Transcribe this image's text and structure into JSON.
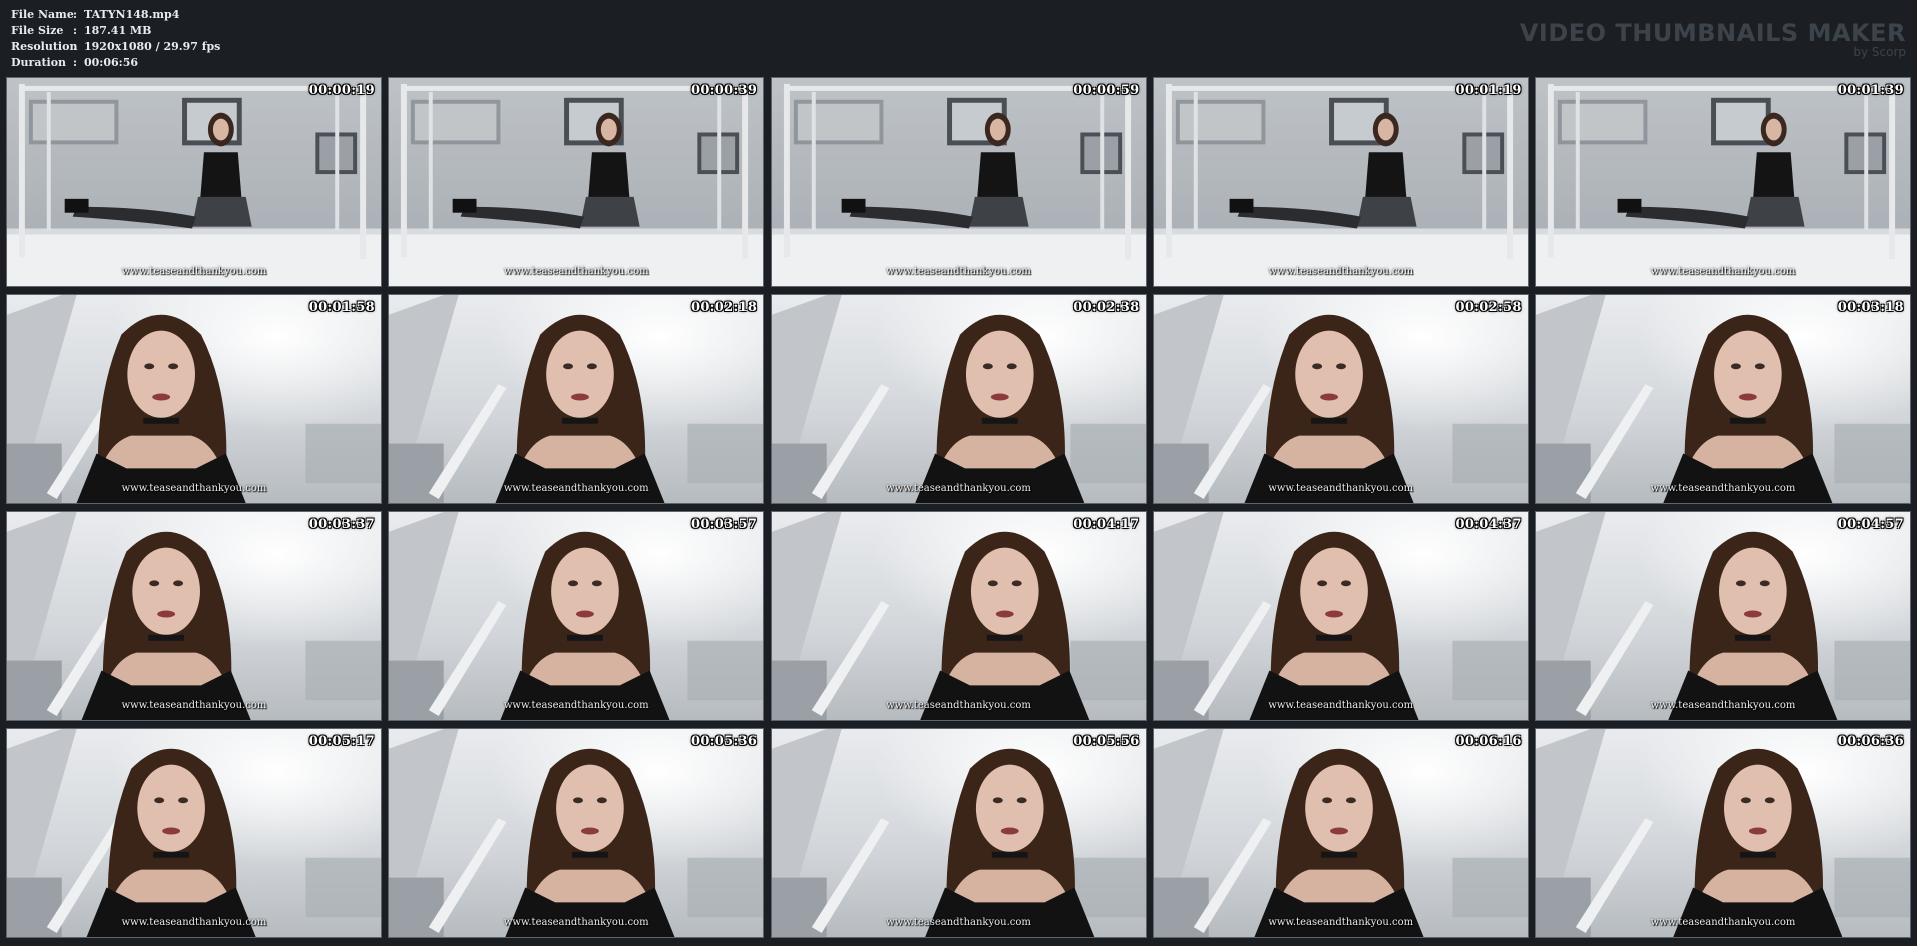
{
  "file_info": [
    {
      "key": "File Name",
      "value": "TATYN148.mp4"
    },
    {
      "key": "File Size",
      "value": "187.41 MB"
    },
    {
      "key": "Resolution",
      "value": "1920x1080 / 29.97 fps"
    },
    {
      "key": "Duration",
      "value": "00:06:56"
    }
  ],
  "separator": ":",
  "brand": {
    "title": "VIDEO THUMBNAILS MAKER",
    "subtitle": "by Scorp"
  },
  "watermark": "www.teaseandthankyou.com",
  "colors": {
    "background": "#1b1f24",
    "header_text": "#e9ecef",
    "brand_text": "#3c434b",
    "thumb_border": "#5d666e"
  },
  "thumbnails": [
    {
      "time": "00:00:19",
      "scene": "bed"
    },
    {
      "time": "00:00:39",
      "scene": "bed"
    },
    {
      "time": "00:00:59",
      "scene": "bed"
    },
    {
      "time": "00:01:19",
      "scene": "bed"
    },
    {
      "time": "00:01:39",
      "scene": "bed"
    },
    {
      "time": "00:01:58",
      "scene": "closeup"
    },
    {
      "time": "00:02:18",
      "scene": "closeup"
    },
    {
      "time": "00:02:38",
      "scene": "closeup"
    },
    {
      "time": "00:02:58",
      "scene": "closeup"
    },
    {
      "time": "00:03:18",
      "scene": "closeup"
    },
    {
      "time": "00:03:37",
      "scene": "closeup"
    },
    {
      "time": "00:03:57",
      "scene": "closeup"
    },
    {
      "time": "00:04:17",
      "scene": "closeup"
    },
    {
      "time": "00:04:37",
      "scene": "closeup"
    },
    {
      "time": "00:04:57",
      "scene": "closeup"
    },
    {
      "time": "00:05:17",
      "scene": "closeup"
    },
    {
      "time": "00:05:36",
      "scene": "closeup"
    },
    {
      "time": "00:05:56",
      "scene": "closeup"
    },
    {
      "time": "00:06:16",
      "scene": "closeup"
    },
    {
      "time": "00:06:36",
      "scene": "closeup"
    }
  ]
}
